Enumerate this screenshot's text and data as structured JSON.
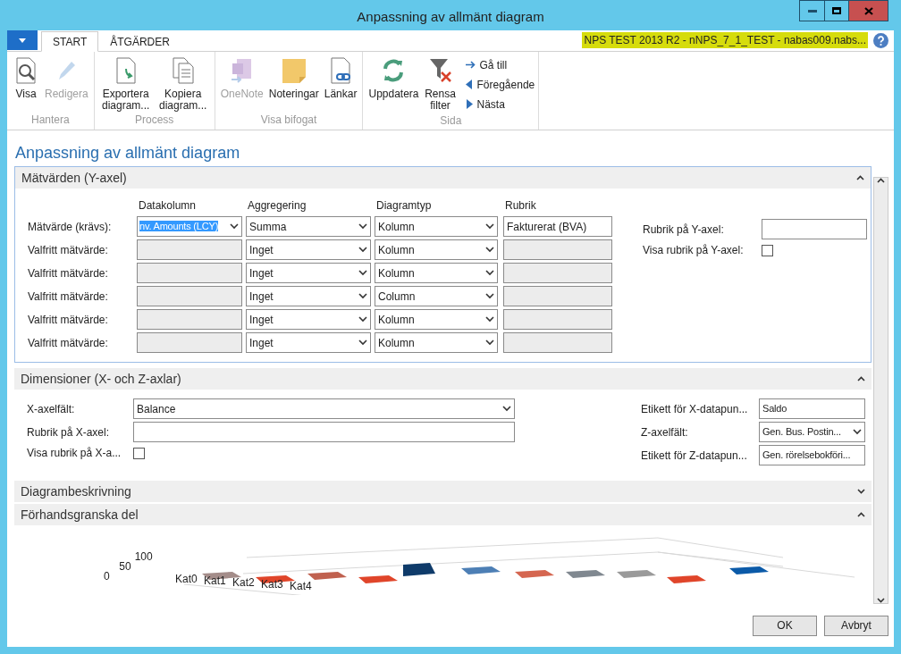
{
  "window": {
    "title": "Anpassning av allmänt diagram"
  },
  "ribbon_tabs": [
    {
      "label": "START",
      "selected": true
    },
    {
      "label": "ÅTGÄRDER",
      "selected": false
    }
  ],
  "connection": "NPS TEST 2013 R2 - nNPS_7_1_TEST - nabas009.nabs...",
  "ribbon_groups": [
    {
      "label": "Hantera",
      "buttons": [
        {
          "kind": "view",
          "label": "Visa",
          "disabled": false
        },
        {
          "kind": "edit",
          "label": "Redigera",
          "disabled": true
        }
      ]
    },
    {
      "label": "Process",
      "buttons": [
        {
          "kind": "export",
          "label": "Exportera diagram...",
          "disabled": false
        },
        {
          "kind": "copy",
          "label": "Kopiera diagram...",
          "disabled": false
        }
      ]
    },
    {
      "label": "Visa bifogat",
      "buttons": [
        {
          "kind": "onenote",
          "label": "OneNote",
          "disabled": true
        },
        {
          "kind": "notes",
          "label": "Noteringar",
          "disabled": false
        },
        {
          "kind": "links",
          "label": "Länkar",
          "disabled": false
        }
      ]
    },
    {
      "label": "Sida",
      "buttons": [
        {
          "kind": "refresh",
          "label": "Uppdatera",
          "disabled": false
        },
        {
          "kind": "filter",
          "label": "Rensa filter",
          "disabled": false
        }
      ],
      "nav": [
        {
          "kind": "goto",
          "label": "Gå till"
        },
        {
          "kind": "prev",
          "label": "Föregående"
        },
        {
          "kind": "next",
          "label": "Nästa"
        }
      ]
    }
  ],
  "page_title": "Anpassning av allmänt diagram",
  "measures": {
    "title": "Mätvärden (Y-axel)",
    "expanded": true,
    "columns": [
      "Datakolumn",
      "Aggregering",
      "Diagramtyp",
      "Rubrik"
    ],
    "rows": [
      {
        "label": "Mätvärde (krävs):",
        "enabled": true,
        "text_selected": true,
        "data_column": "nv. Amounts (LCY)",
        "aggregation": "Summa",
        "chart_type": "Kolumn",
        "caption": "Fakturerat (BVA)"
      },
      {
        "label": "Valfritt mätvärde:",
        "enabled": false,
        "aggregation": "Inget",
        "chart_type": "Kolumn"
      },
      {
        "label": "Valfritt mätvärde:",
        "enabled": false,
        "aggregation": "Inget",
        "chart_type": "Kolumn"
      },
      {
        "label": "Valfritt mätvärde:",
        "enabled": false,
        "aggregation": "Inget",
        "chart_type": "Column"
      },
      {
        "label": "Valfritt mätvärde:",
        "enabled": false,
        "aggregation": "Inget",
        "chart_type": "Kolumn"
      },
      {
        "label": "Valfritt mätvärde:",
        "enabled": false,
        "aggregation": "Inget",
        "chart_type": "Kolumn"
      }
    ],
    "y_caption_label": "Rubrik på Y-axel:",
    "show_y_caption_label": "Visa rubrik på Y-axel:",
    "show_y_caption": false
  },
  "dimensions": {
    "title": "Dimensioner (X- och Z-axlar)",
    "expanded": true,
    "left": [
      {
        "kind": "select",
        "label": "X-axelfält:",
        "value": "Balance"
      },
      {
        "kind": "text",
        "label": "Rubrik på X-axel:"
      },
      {
        "kind": "checkbox",
        "label": "Visa rubrik på X-a...",
        "checked": false
      }
    ],
    "right": [
      {
        "kind": "text",
        "label": "Etikett för X-datapun...",
        "value": "Saldo"
      },
      {
        "kind": "select",
        "label": "Z-axelfält:",
        "value": "Gen. Bus. Postin..."
      },
      {
        "kind": "text",
        "label": "Etikett för Z-datapun...",
        "value": "Gen. rörelsebokföri..."
      }
    ]
  },
  "collapsed_sections": [
    {
      "title": "Diagrambeskrivning",
      "expanded": false
    },
    {
      "title": "Förhandsgranska del",
      "expanded": true
    }
  ],
  "preview": {
    "ytick_labels": [
      "100",
      "50",
      "0"
    ],
    "category_labels": [
      "Kat0",
      "Kat1",
      "Kat2",
      "Kat3",
      "Kat4"
    ]
  },
  "buttons": [
    "OK",
    "Avbryt"
  ]
}
